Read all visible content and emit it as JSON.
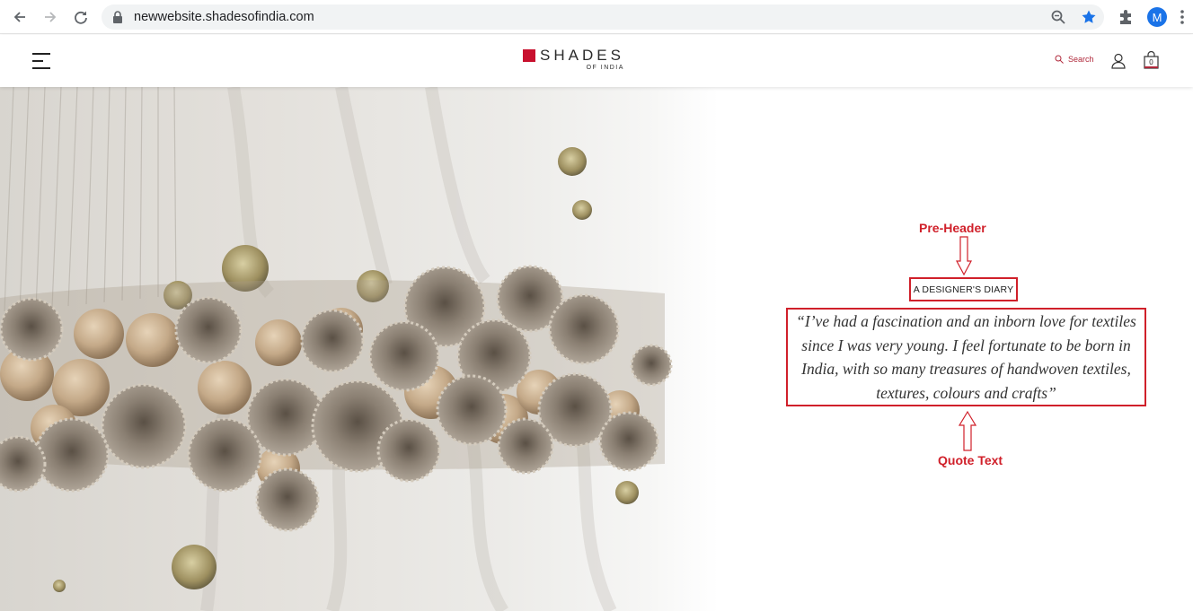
{
  "browser": {
    "url": "newwebsite.shadesofindia.com",
    "profile_initial": "M",
    "icons": [
      "back-arrow-icon",
      "forward-arrow-icon",
      "reload-icon",
      "lock-icon",
      "zoom-icon",
      "bookmark-star-icon",
      "extensions-puzzle-icon",
      "kebab-menu-icon"
    ]
  },
  "header": {
    "logo_main": "SHADES",
    "logo_sub": "OF INDIA",
    "search_label": "Search",
    "cart_count": "0"
  },
  "hero": {
    "pre_header": "A DESIGNER'S DIARY",
    "quote": "“I’ve had a fascination and an inborn love for textiles since I was very young. I feel fortunate to be born in India, with so many treasures of handwoven textiles, textures, colours and crafts”"
  },
  "annotations": {
    "pre_header_label": "Pre-Header",
    "quote_label": "Quote Text"
  },
  "colors": {
    "brand_red": "#c8102e",
    "annotation_red": "#d0202a",
    "chrome_blue": "#1a73e8"
  }
}
